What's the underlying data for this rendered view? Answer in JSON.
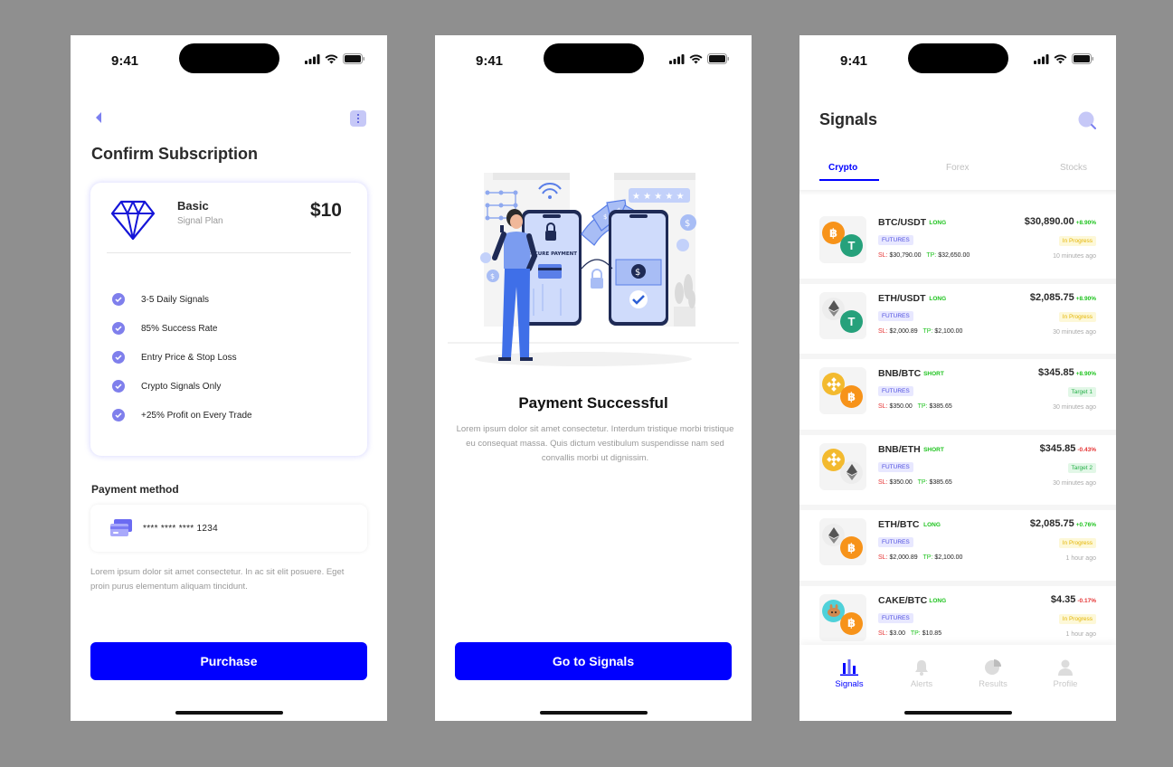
{
  "status_bar": {
    "time": "9:41"
  },
  "confirm": {
    "title": "Confirm Subscription",
    "plan": {
      "name": "Basic",
      "subtitle": "Signal Plan",
      "price": "$10"
    },
    "features": [
      "3-5 Daily Signals",
      "85% Success Rate",
      "Entry Price & Stop Loss",
      "Crypto Signals Only",
      "+25% Profit on Every Trade"
    ],
    "payment_label": "Payment method",
    "card_number": "**** **** **** 1234",
    "note": "Lorem ipsum dolor sit amet consectetur. In ac sit elit posuere. Eget proin purus elementum aliquam tincidunt.",
    "cta": "Purchase"
  },
  "success": {
    "illustration_label": "SECURE PAYMENT",
    "title": "Payment Successful",
    "text": "Lorem ipsum dolor sit amet consectetur. Interdum tristique morbi tristique eu consequat massa. Quis dictum vestibulum suspendisse nam sed convallis morbi ut dignissim.",
    "cta": "Go to Signals"
  },
  "signals": {
    "title": "Signals",
    "tabs": [
      "Crypto",
      "Forex",
      "Stocks"
    ],
    "active_tab": "Crypto",
    "futures_label": "FUTURES",
    "sl_label": "SL:",
    "tp_label": "TP:",
    "rows": [
      {
        "pair": "BTC/USDT",
        "direction": "LONG",
        "price": "$30,890.00",
        "change": "+8.90%",
        "status": "In Progress",
        "sl": "$30,790.00",
        "tp": "$32,650.00",
        "time": "10 minutes ago",
        "coin_a": "btc",
        "coin_b": "usdt"
      },
      {
        "pair": "ETH/USDT",
        "direction": "LONG",
        "price": "$2,085.75",
        "change": "+8.90%",
        "status": "In Progress",
        "sl": "$2,000.89",
        "tp": "$2,100.00",
        "time": "30 minutes ago",
        "coin_a": "eth",
        "coin_b": "usdt"
      },
      {
        "pair": "BNB/BTC",
        "direction": "SHORT",
        "price": "$345.85",
        "change": "+8.90%",
        "status": "Target 1",
        "sl": "$350.00",
        "tp": "$385.65",
        "time": "30 minutes ago",
        "coin_a": "bnb",
        "coin_b": "btc"
      },
      {
        "pair": "BNB/ETH",
        "direction": "SHORT",
        "price": "$345.85",
        "change": "-0.43%",
        "status": "Target 2",
        "sl": "$350.00",
        "tp": "$385.65",
        "time": "30 minutes ago",
        "coin_a": "bnb",
        "coin_b": "eth"
      },
      {
        "pair": "ETH/BTC",
        "direction": "LONG",
        "price": "$2,085.75",
        "change": "+0.76%",
        "status": "In Progress",
        "sl": "$2,000.89",
        "tp": "$2,100.00",
        "time": "1 hour ago",
        "coin_a": "eth",
        "coin_b": "btc"
      },
      {
        "pair": "CAKE/BTC",
        "direction": "LONG",
        "price": "$4.35",
        "change": "-0.17%",
        "status": "In Progress",
        "sl": "$3.00",
        "tp": "$10.85",
        "time": "1 hour ago",
        "coin_a": "cake",
        "coin_b": "btc"
      }
    ],
    "nav": [
      "Signals",
      "Alerts",
      "Results",
      "Profile"
    ],
    "active_nav": "Signals"
  },
  "colors": {
    "primary": "#0000ff",
    "accent": "#7f7fec",
    "positive": "#1ec31e",
    "negative": "#e53333",
    "btc": "#f7931a",
    "usdt": "#26a17b",
    "bnb": "#f3ba2f",
    "eth": "#8c8c8c",
    "cake": "#4fd1d9"
  }
}
